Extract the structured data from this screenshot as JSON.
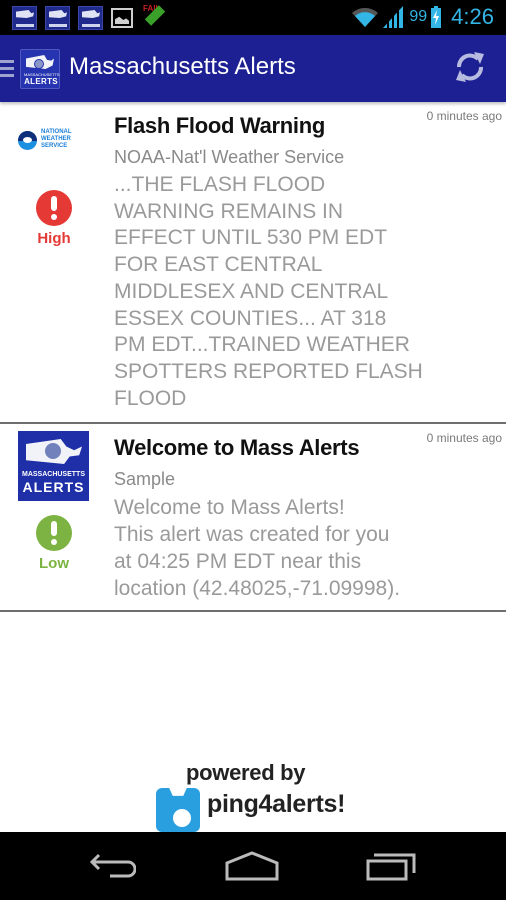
{
  "status_bar": {
    "notification_icons": [
      "mass-alerts-notification-icon",
      "mass-alerts-notification-icon",
      "mass-alerts-notification-icon",
      "gallery-notification-icon",
      "upload-failed-notification-icon"
    ],
    "fail_label": "FAIL",
    "battery_percent": "99",
    "time": "4:26",
    "accent_color": "#33b5e5"
  },
  "action_bar": {
    "title": "Massachusetts Alerts",
    "logo_line1": "MASSACHUSETTS",
    "logo_line2": "ALERTS",
    "refresh_icon": "refresh-icon",
    "background_color": "#1c2092"
  },
  "alerts": [
    {
      "time": "0 minutes ago",
      "title": "Flash Flood Warning",
      "source": "NOAA-Nat'l Weather Service",
      "source_logo": "national-weather-service-logo",
      "source_logo_text": "NATIONAL\nWEATHER\nSERVICE",
      "body": "...THE FLASH FLOOD\nWARNING REMAINS IN\nEFFECT UNTIL 530 PM EDT\nFOR EAST CENTRAL\nMIDDLESEX AND CENTRAL\nESSEX COUNTIES... AT 318\nPM EDT...TRAINED WEATHER\nSPOTTERS REPORTED FLASH\nFLOOD",
      "priority": "High",
      "priority_color": "#e53935"
    },
    {
      "time": "0 minutes ago",
      "title": "Welcome to Mass Alerts",
      "source": "Sample",
      "source_logo": "massachusetts-alerts-logo",
      "source_logo_line1": "MASSACHUSETTS",
      "source_logo_line2": "ALERTS",
      "body": "Welcome to Mass Alerts!\nThis alert was created for you\nat 04:25 PM EDT near this\nlocation (42.48025,-71.09998).",
      "priority": "Low",
      "priority_color": "#7cb342"
    }
  ],
  "footer": {
    "powered_by": "powered by",
    "brand": "ping4alerts!",
    "brand_color": "#2a9fe0"
  },
  "nav_bar": {
    "buttons": [
      "back",
      "home",
      "recent-apps"
    ]
  }
}
